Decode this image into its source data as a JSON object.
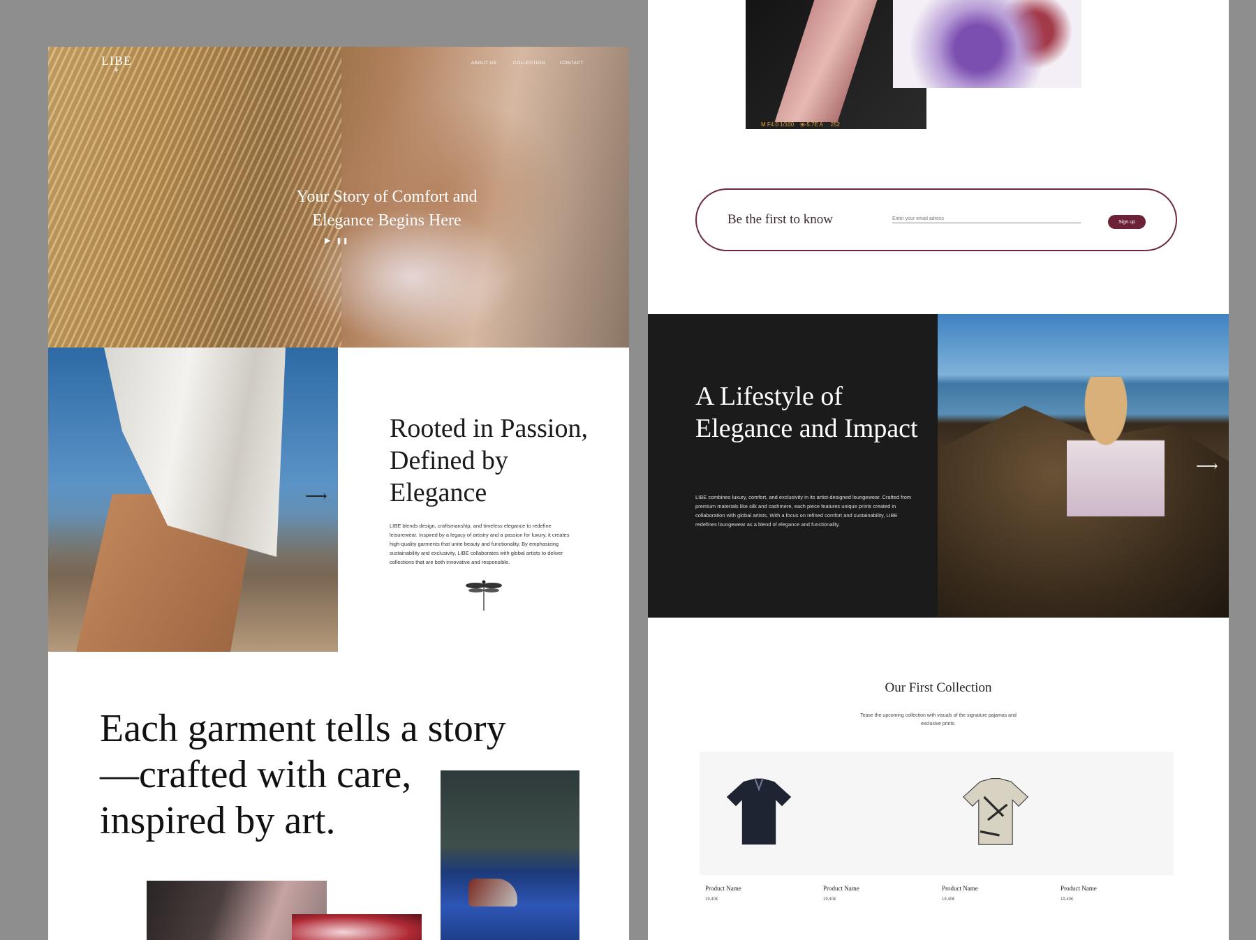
{
  "left_page": {
    "header": {
      "logo": "LIBE",
      "logo_mark": "⚘",
      "nav": [
        "ABOUT US",
        "COLLECTION",
        "CONTACT"
      ]
    },
    "hero": {
      "title_line1": "Your Story of Comfort and",
      "title_line2": "Elegance Begins Here",
      "play_icon": "▶",
      "pause_icon": "❚❚"
    },
    "about": {
      "heading": "Rooted in Passion, Defined by Elegance",
      "body": "LIBE blends design, craftsmanship, and timeless elegance to redefine leisurewear. Inspired by a legacy of artistry and a passion for luxury, it creates high-quality garments that unite beauty and functionality. By emphasizing sustainability and exclusivity, LIBE collaborates with global artists to deliver collections that are both innovative and responsible.",
      "arrow": "⟶"
    },
    "story": {
      "line1": "Each garment tells a story",
      "line2": "—crafted with care,",
      "line3": "inspired by art."
    }
  },
  "right_page": {
    "film_strip_text": "M F4.0 1/100    ⊞-5.7E A     252",
    "newsletter": {
      "title": "Be the first to know",
      "placeholder": "Enter your email adress",
      "button": "Sign up"
    },
    "lifestyle": {
      "heading": "A Lifestyle of Elegance and Impact",
      "body": "LIBE combines luxury, comfort, and exclusivity in its artist-designed loungewear. Crafted from premium materials like silk and cashmere, each piece features unique prints created in collaboration with global artists. With a focus on refined comfort and sustainability, LIBE redefines loungewear as a blend of elegance and functionality.",
      "arrow": "⟶"
    },
    "collection": {
      "title": "Our First Collection",
      "subtitle": "Tease the upcoming collection with visuals of the signature pajamas and exclusive prints.",
      "products": [
        {
          "name": "Product Name",
          "price": "19,40€"
        },
        {
          "name": "Product Name",
          "price": "19,40€"
        },
        {
          "name": "Product Name",
          "price": "19,40€"
        },
        {
          "name": "Product Name",
          "price": "19,40€"
        }
      ]
    }
  },
  "colors": {
    "background": "#8e8e8e",
    "accent_wine": "#6c2236",
    "dark_panel": "#1b1b1b"
  }
}
